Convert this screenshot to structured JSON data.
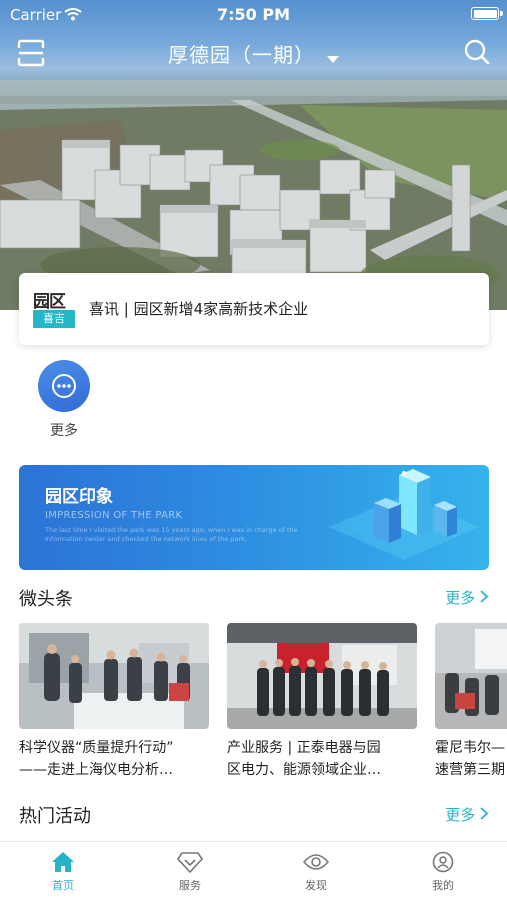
{
  "status_bar": {
    "carrier": "Carrier",
    "time": "7:50 PM"
  },
  "nav": {
    "title": "厚德园（一期）"
  },
  "news": {
    "logo_top": "园区",
    "logo_bottom": "喜吉",
    "text": "喜讯 | 园区新增4家高新技术企业"
  },
  "quick_actions": [
    {
      "label": "更多"
    }
  ],
  "banner": {
    "title": "园区印象",
    "subtitle": "IMPRESSION OF THE PARK",
    "description": "The last time I visited the park was 15 years ago, when I was in charge of the information center and checked the network lines of the park."
  },
  "sections": {
    "headlines": {
      "title": "微头条",
      "more": "更多"
    },
    "events": {
      "title": "热门活动",
      "more": "更多"
    }
  },
  "articles": [
    {
      "line1": "科学仪器“质量提升行动”",
      "line2": "——走进上海仪电分析…"
    },
    {
      "line1": "产业服务 | 正泰电器与园",
      "line2": "区电力、能源领域企业…"
    },
    {
      "line1": "霍尼韦尔—",
      "line2": "速营第三期"
    }
  ],
  "tabbar": [
    {
      "label": "首页",
      "icon": "home-icon",
      "active": true
    },
    {
      "label": "服务",
      "icon": "diamond-icon",
      "active": false
    },
    {
      "label": "发现",
      "icon": "eye-icon",
      "active": false
    },
    {
      "label": "我的",
      "icon": "profile-icon",
      "active": false
    }
  ],
  "colors": {
    "accent": "#27b3c9",
    "blue": "#3a7be0"
  }
}
